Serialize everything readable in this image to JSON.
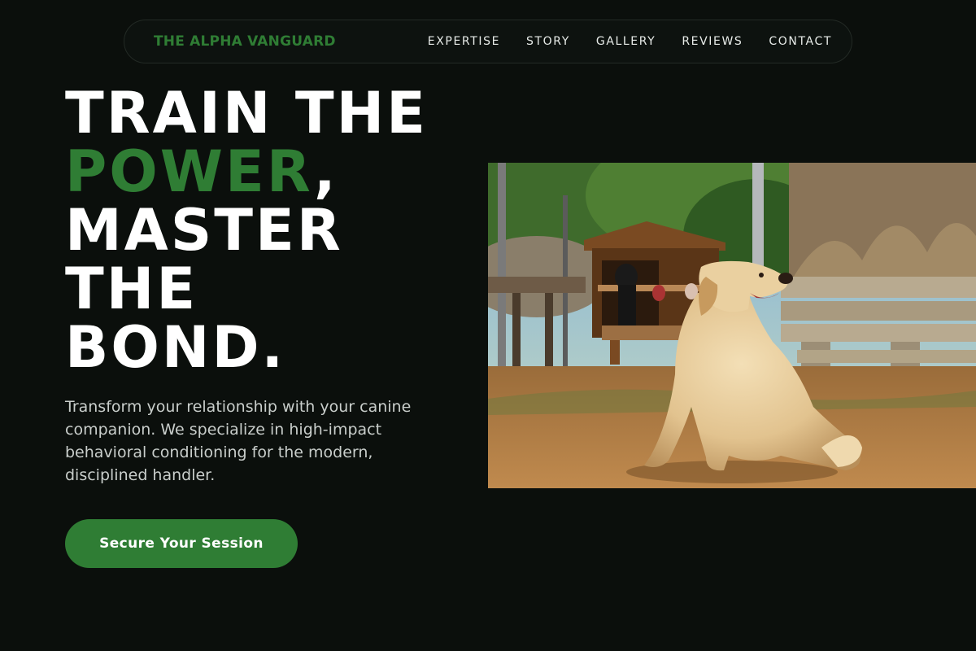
{
  "nav": {
    "brand": "THE ALPHA VANGUARD",
    "links": [
      "EXPERTISE",
      "STORY",
      "GALLERY",
      "REVIEWS",
      "CONTACT"
    ]
  },
  "hero": {
    "headline": {
      "line1": "TRAIN THE",
      "accent": "POWER",
      "accent_suffix": ",",
      "line3": "MASTER",
      "line4": "THE",
      "line5": "BOND."
    },
    "description": "Transform your relationship with your canine companion. We specialize in high-impact behavioral conditioning for the modern, disciplined handler.",
    "cta_label": "Secure Your Session"
  },
  "colors": {
    "background": "#0b0f0c",
    "accent": "#2f7d34",
    "nav_border": "#232a25"
  }
}
